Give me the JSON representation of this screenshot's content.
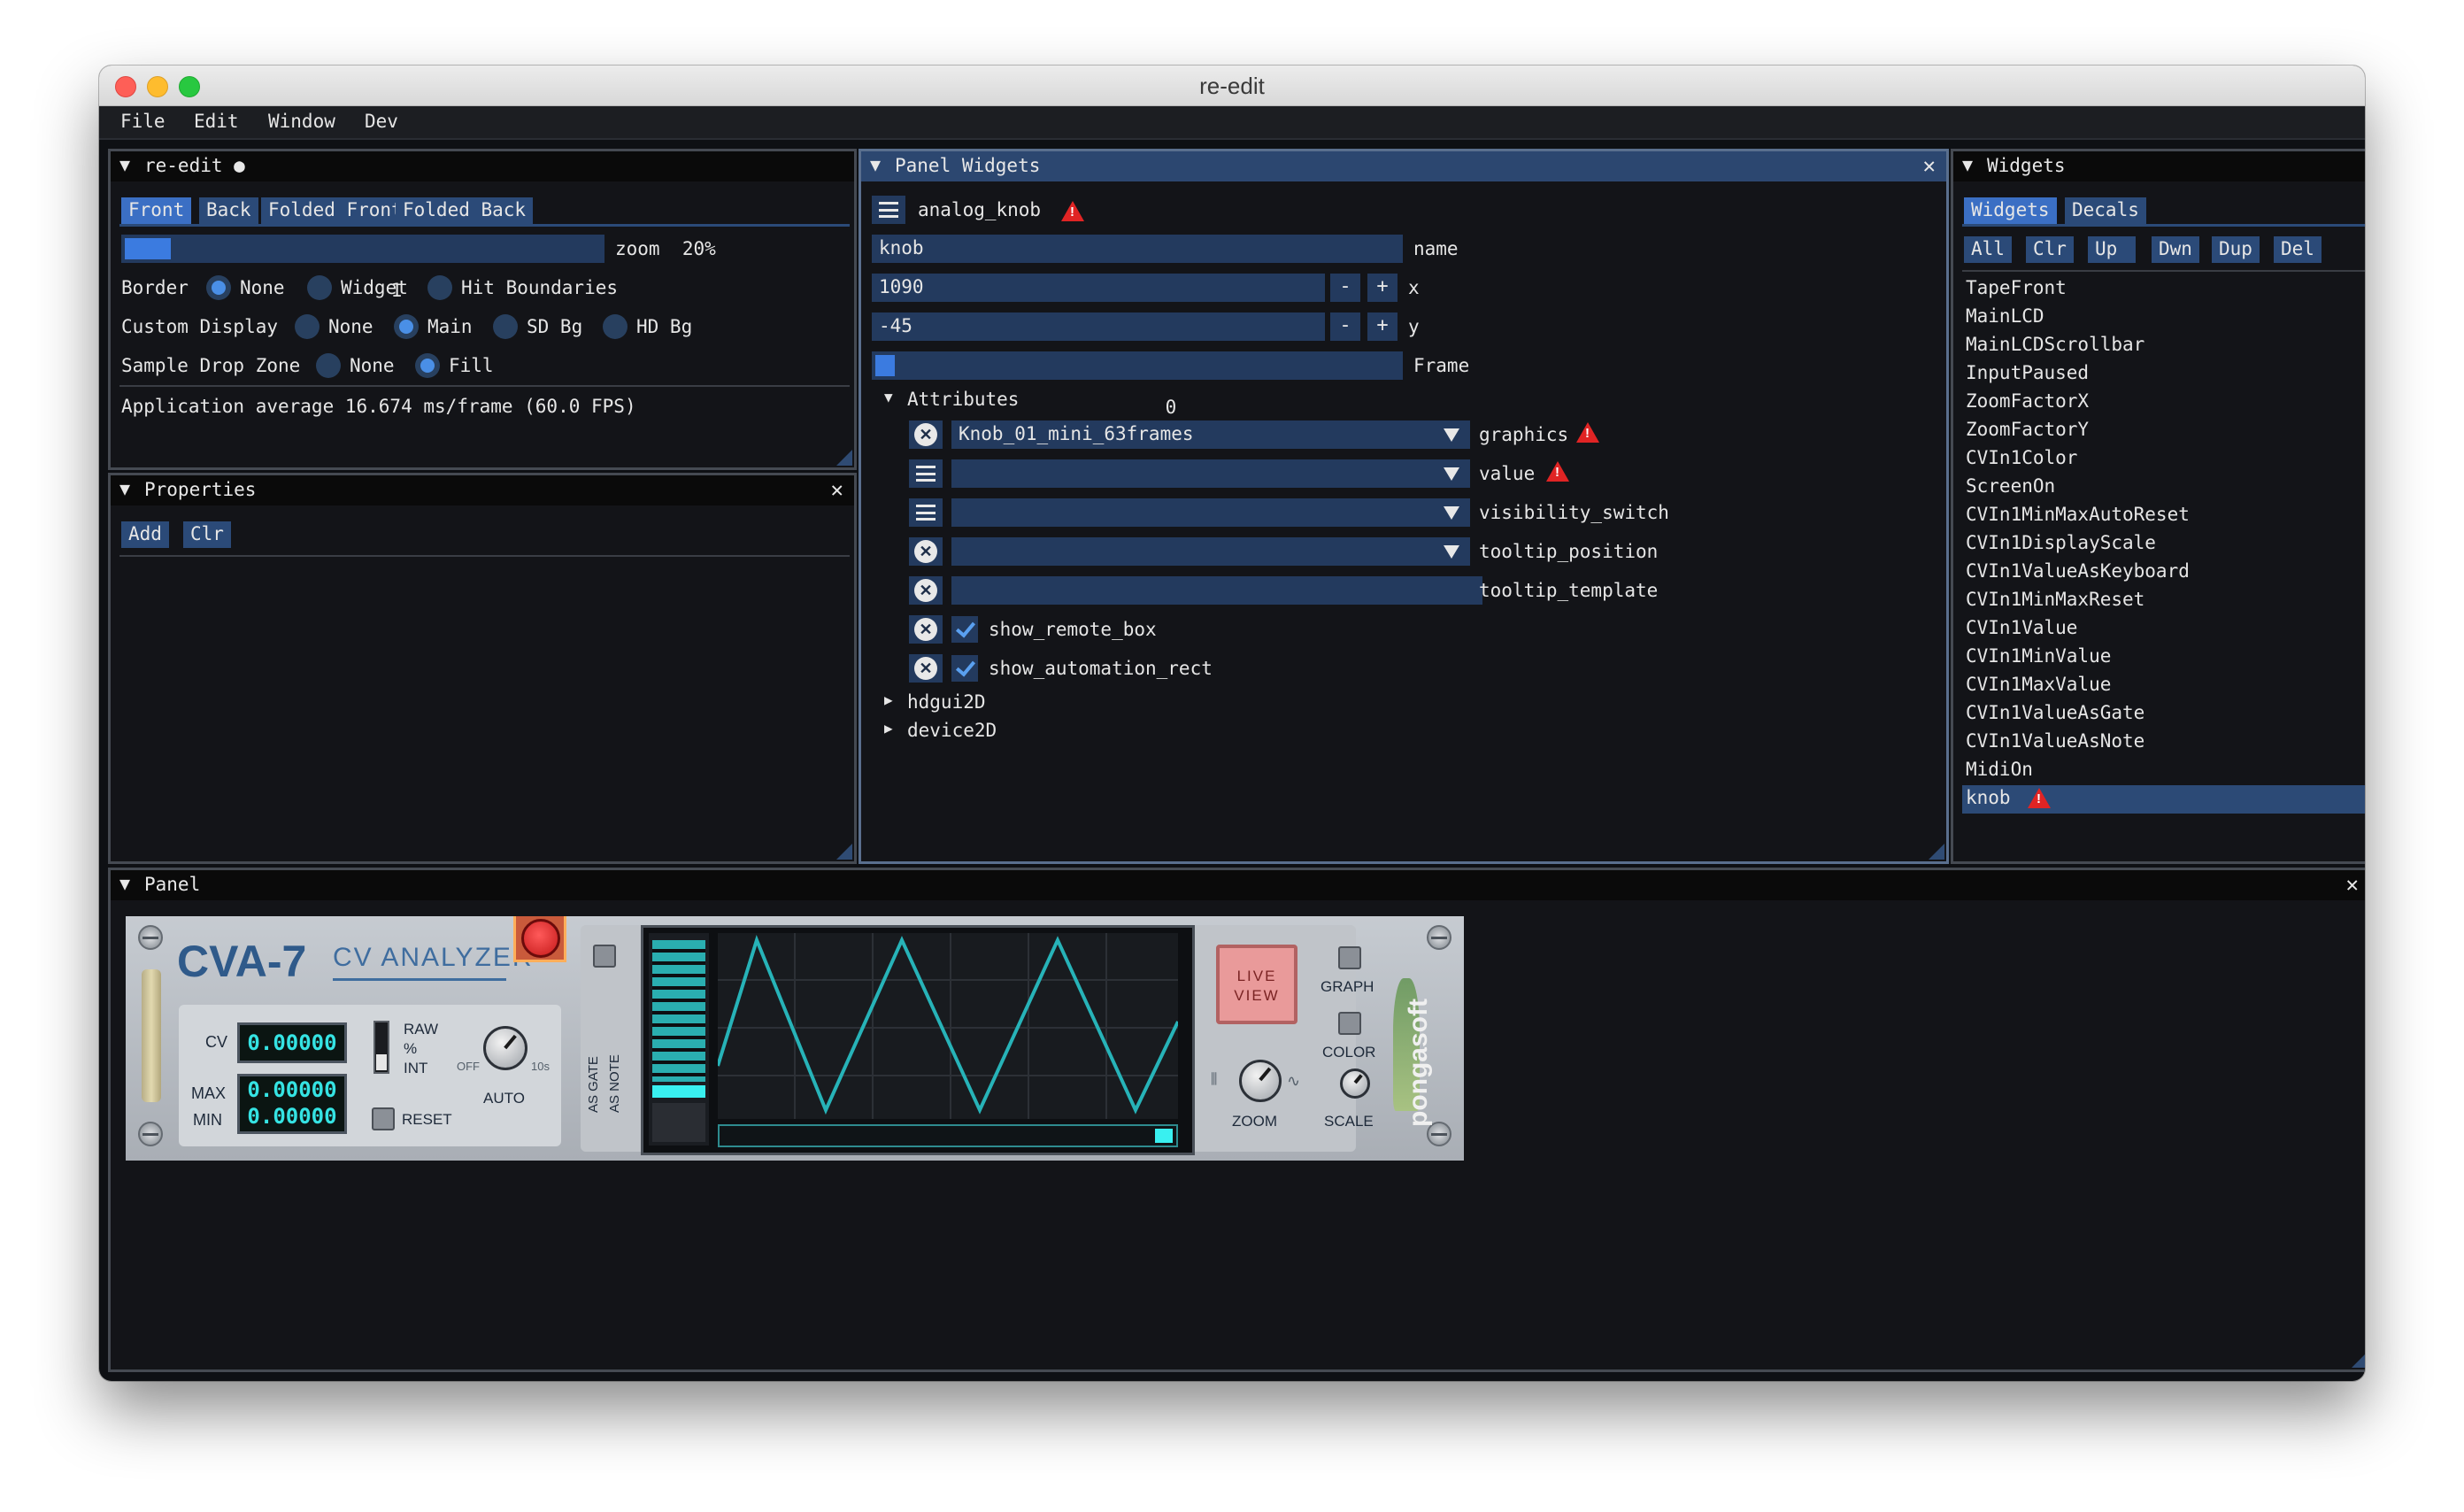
{
  "window": {
    "title": "re-edit"
  },
  "menu": [
    "File",
    "Edit",
    "Window",
    "Dev"
  ],
  "reedit": {
    "title": "re-edit ●",
    "tabs": [
      "Front",
      "Back",
      "Folded Front",
      "Folded Back"
    ],
    "zoom_slider_value": "1",
    "zoom_label": "zoom  20%",
    "border_label": "Border",
    "border_options": [
      "None",
      "Widget",
      "Hit Boundaries"
    ],
    "custom_display_label": "Custom Display",
    "custom_display_options": [
      "None",
      "Main",
      "SD Bg",
      "HD Bg"
    ],
    "sample_drop_label": "Sample Drop Zone",
    "sample_drop_options": [
      "None",
      "Fill"
    ],
    "fps_text": "Application average 16.674 ms/frame (60.0 FPS)"
  },
  "properties": {
    "title": "Properties",
    "add": "Add",
    "clr": "Clr"
  },
  "panel_widgets": {
    "title": "Panel Widgets",
    "widget_type": "analog_knob",
    "name_value": "knob",
    "name_label": "name",
    "x_value": "1090",
    "x_label": "x",
    "y_value": "-45",
    "y_label": "y",
    "frame_value": "0",
    "frame_label": "Frame",
    "minus": "-",
    "plus": "+",
    "attributes_label": "Attributes",
    "attributes": [
      {
        "value": "Knob_01_mini_63frames",
        "label": "graphics"
      },
      {
        "value": "",
        "label": "value"
      },
      {
        "value": "",
        "label": "visibility_switch"
      },
      {
        "value": "",
        "label": "tooltip_position"
      },
      {
        "value": "",
        "label": "tooltip_template"
      },
      {
        "value": "",
        "label": "show_remote_box"
      },
      {
        "value": "",
        "label": "show_automation_rect"
      }
    ],
    "hdgui": "hdgui2D",
    "device": "device2D"
  },
  "widgets": {
    "title": "Widgets",
    "tabs": [
      "Widgets",
      "Decals"
    ],
    "buttons": [
      "All",
      "Clr",
      "Up",
      "Dwn",
      "Dup",
      "Del"
    ],
    "list": [
      "TapeFront",
      "MainLCD",
      "MainLCDScrollbar",
      "InputPaused",
      "ZoomFactorX",
      "ZoomFactorY",
      "CVIn1Color",
      "ScreenOn",
      "CVIn1MinMaxAutoReset",
      "CVIn1DisplayScale",
      "CVIn1ValueAsKeyboard",
      "CVIn1MinMaxReset",
      "CVIn1Value",
      "CVIn1MinValue",
      "CVIn1MaxValue",
      "CVIn1ValueAsGate",
      "CVIn1ValueAsNote",
      "MidiOn",
      "knob"
    ],
    "selected": "knob"
  },
  "panel": {
    "title": "Panel",
    "device": {
      "model": "CVA-7",
      "name": "CV ANALYZER",
      "cv_label": "CV",
      "cv_value": "0.00000",
      "max_label": "MAX",
      "max_value": "0.00000",
      "min_label": "MIN",
      "min_value": "0.00000",
      "raw": "RAW",
      "pct": "%",
      "int": "INT",
      "off": "OFF",
      "ten": "10s",
      "auto": "AUTO",
      "reset": "RESET",
      "as_gate": "AS GATE",
      "as_note": "AS NOTE",
      "live": "LIVE",
      "view": "VIEW",
      "graph": "GRAPH",
      "color": "COLOR",
      "zoom": "ZOOM",
      "scale": "SCALE",
      "brand": "pongasoft"
    }
  },
  "colors": {
    "accent": "#2b4a78",
    "active_header": "#2c4770",
    "warning": "#e02424",
    "lcd": "#35e3e3"
  }
}
